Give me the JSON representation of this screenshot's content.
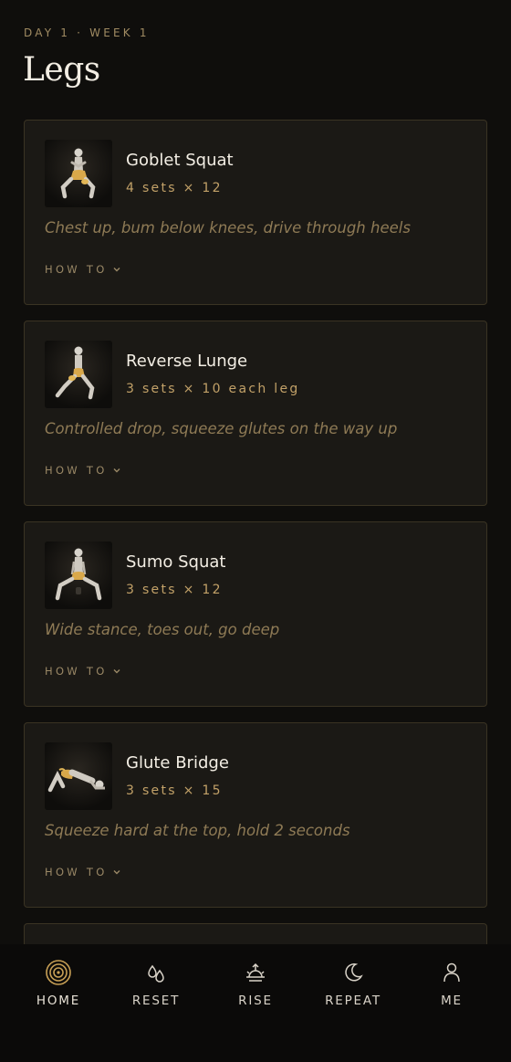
{
  "header": {
    "eyebrow": "DAY 1 · WEEK 1",
    "title": "Legs"
  },
  "exercises": [
    {
      "name": "Goblet Squat",
      "sets": "4 sets × 12",
      "tip": "Chest up, bum below knees, drive through heels",
      "howto": "HOW TO"
    },
    {
      "name": "Reverse Lunge",
      "sets": "3 sets × 10 each leg",
      "tip": "Controlled drop, squeeze glutes on the way up",
      "howto": "HOW TO"
    },
    {
      "name": "Sumo Squat",
      "sets": "3 sets × 12",
      "tip": "Wide stance, toes out, go deep",
      "howto": "HOW TO"
    },
    {
      "name": "Glute Bridge",
      "sets": "3 sets × 15",
      "tip": "Squeeze hard at the top, hold 2 seconds",
      "howto": "HOW TO"
    }
  ],
  "tabbar": {
    "tabs": [
      {
        "label": "HOME",
        "icon": "home-rings-icon",
        "active": true
      },
      {
        "label": "RESET",
        "icon": "drops-icon",
        "active": false
      },
      {
        "label": "RISE",
        "icon": "sunrise-icon",
        "active": false
      },
      {
        "label": "REPEAT",
        "icon": "moon-icon",
        "active": false
      },
      {
        "label": "ME",
        "icon": "person-icon",
        "active": false
      }
    ]
  },
  "colors": {
    "background": "#0f0e0c",
    "card": "#1b1915",
    "card_border": "#3a3323",
    "accent_gold": "#c2a168",
    "muted_gold": "#8e7a55"
  }
}
